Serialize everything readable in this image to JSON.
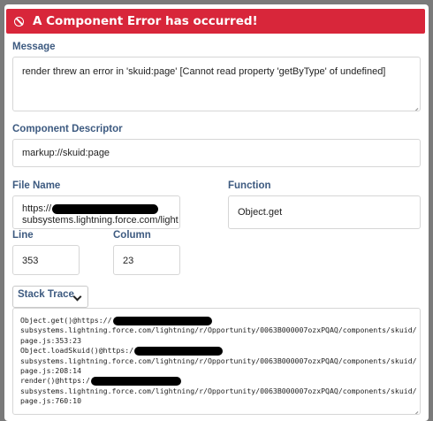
{
  "header": {
    "title": "A Component Error has occurred!",
    "icon": "ban-icon",
    "color": "#d8263a"
  },
  "message": {
    "label": "Message",
    "value": "render threw an error in 'skuid:page' [Cannot read property 'getByType' of undefined]"
  },
  "descriptor": {
    "label": "Component Descriptor",
    "value": "markup://skuid:page"
  },
  "file": {
    "label": "File Name",
    "line1": "https://",
    "line2": "subsystems.lightning.force.com/light"
  },
  "function": {
    "label": "Function",
    "value": "Object.get"
  },
  "line": {
    "label": "Line",
    "value": "353"
  },
  "column": {
    "label": "Column",
    "value": "23"
  },
  "stack": {
    "selector_label": "Stack Trace",
    "lines": [
      "Object.get()@https://",
      "subsystems.lightning.force.com/lightning/r/Opportunity/0063B000007ozxPQAQ/components/skuid/",
      "page.js:353:23",
      "Object.loadSkuid()@https:/",
      "subsystems.lightning.force.com/lightning/r/Opportunity/0063B000007ozxPQAQ/components/skuid/",
      "page.js:208:14",
      "render()@https:/",
      "subsystems.lightning.force.com/lightning/r/Opportunity/0063B000007ozxPQAQ/components/skuid/",
      "page.js:760:10"
    ]
  }
}
